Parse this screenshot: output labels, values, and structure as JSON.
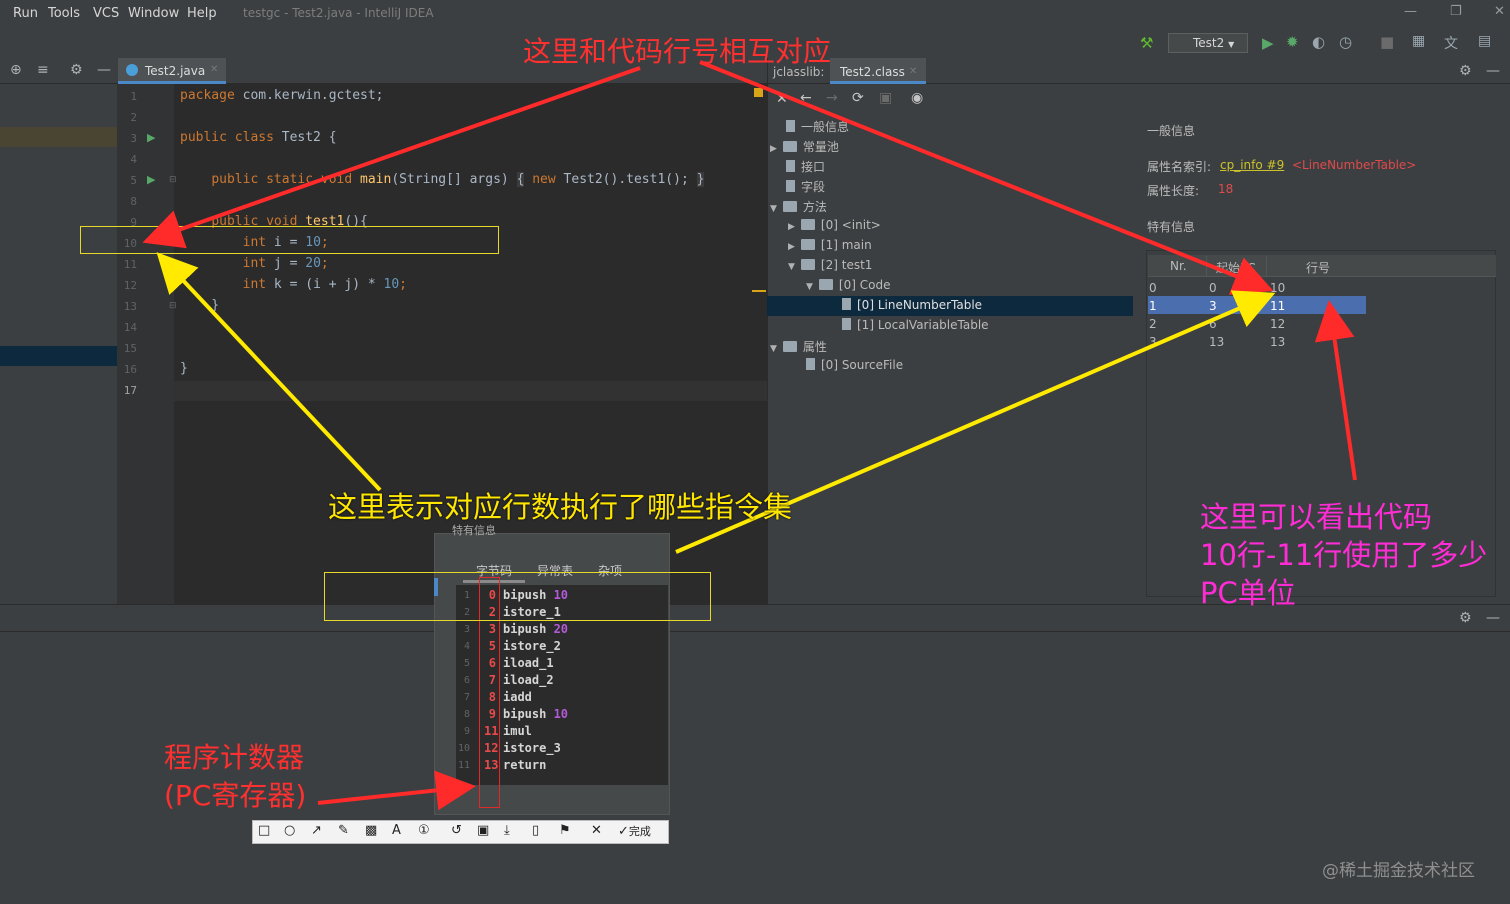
{
  "menubar": {
    "items": [
      "Run",
      "Tools",
      "VCS",
      "Window",
      "Help"
    ],
    "title": "testgc - Test2.java - IntelliJ IDEA"
  },
  "toolbar": {
    "run_config": "Test2"
  },
  "editor": {
    "tab": "Test2.java",
    "line_numbers": [
      "1",
      "2",
      "3",
      "4",
      "5",
      "8",
      "9",
      "10",
      "11",
      "12",
      "13",
      "14",
      "15",
      "16",
      "17"
    ]
  },
  "jclasslib": {
    "label": "jclasslib:",
    "tab": "Test2.class",
    "tree": {
      "general": "一般信息",
      "constant_pool": "常量池",
      "interfaces": "接口",
      "fields": "字段",
      "methods": "方法",
      "m_init": "[0] <init>",
      "m_main": "[1] main",
      "m_test1": "[2] test1",
      "code": "[0] Code",
      "lnt": "[0] LineNumberTable",
      "lvt": "[1] LocalVariableTable",
      "attributes": "属性",
      "sourcefile": "[0] SourceFile"
    },
    "info": {
      "general_heading": "一般信息",
      "name_index_label": "属性名索引:",
      "name_index_link": "cp_info #9",
      "name_index_value": "<LineNumberTable>",
      "length_label": "属性长度:",
      "length_value": "18",
      "specific_heading": "特有信息"
    },
    "table": {
      "headers": [
        "Nr.",
        "起始PC",
        "行号"
      ],
      "rows": [
        [
          "0",
          "0",
          "10"
        ],
        [
          "1",
          "3",
          "11"
        ],
        [
          "2",
          "6",
          "12"
        ],
        [
          "3",
          "13",
          "13"
        ]
      ]
    }
  },
  "bytecode_popup": {
    "heading": "特有信息",
    "tabs": [
      "字节码",
      "异常表",
      "杂项"
    ],
    "instructions": [
      [
        "1",
        "0",
        "bipush 10"
      ],
      [
        "2",
        "2",
        "istore_1"
      ],
      [
        "3",
        "3",
        "bipush 20"
      ],
      [
        "4",
        "5",
        "istore_2"
      ],
      [
        "5",
        "6",
        "iload_1"
      ],
      [
        "6",
        "7",
        "iload_2"
      ],
      [
        "7",
        "8",
        "iadd"
      ],
      [
        "8",
        "9",
        "bipush 10"
      ],
      [
        "9",
        "11",
        "imul"
      ],
      [
        "10",
        "12",
        "istore_3"
      ],
      [
        "11",
        "13",
        "return"
      ]
    ]
  },
  "screenshot_tools": {
    "done": "完成"
  },
  "annotations": {
    "top": "这里和代码行号相互对应",
    "middle": "这里表示对应行数执行了哪些指令集",
    "right": [
      "这里可以看出代码",
      "10行-11行使用了多少",
      "PC单位"
    ],
    "bottom": [
      "程序计数器",
      "(PC寄存器)"
    ]
  },
  "watermark": "@稀土掘金技术社区"
}
